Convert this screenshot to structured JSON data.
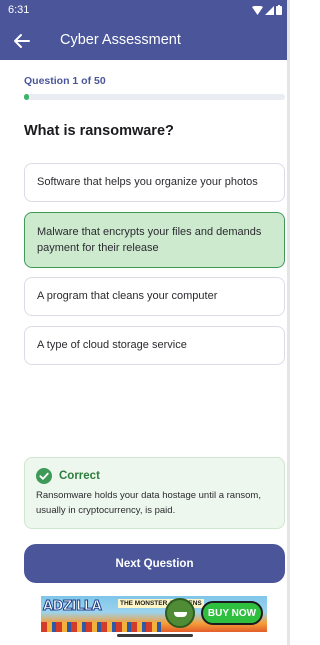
{
  "status_bar": {
    "time": "6:31"
  },
  "app_bar": {
    "title": "Cyber Assessment"
  },
  "quiz": {
    "counter": "Question 1 of 50",
    "progress_fraction": 0.02,
    "question": "What is ransomware?",
    "options": [
      {
        "label": "Software that helps you organize your photos",
        "state": "default"
      },
      {
        "label": "Malware that encrypts your files and demands payment for their release",
        "state": "correct"
      },
      {
        "label": "A program that cleans your computer",
        "state": "default"
      },
      {
        "label": "A type of cloud storage service",
        "state": "default"
      }
    ]
  },
  "feedback": {
    "title": "Correct",
    "text": "Ransomware holds your data hostage until a ransom, usually in cryptocurrency, is paid."
  },
  "next_button": {
    "label": "Next Question"
  },
  "ad": {
    "brand": "ADZILLA",
    "tagline": "THE MONSTER AWAKENS",
    "cta": "BUY NOW"
  },
  "colors": {
    "primary": "#4a5699",
    "correct_bg": "#cdeacf",
    "correct_border": "#3f9a57",
    "success": "#2d7d3f"
  }
}
